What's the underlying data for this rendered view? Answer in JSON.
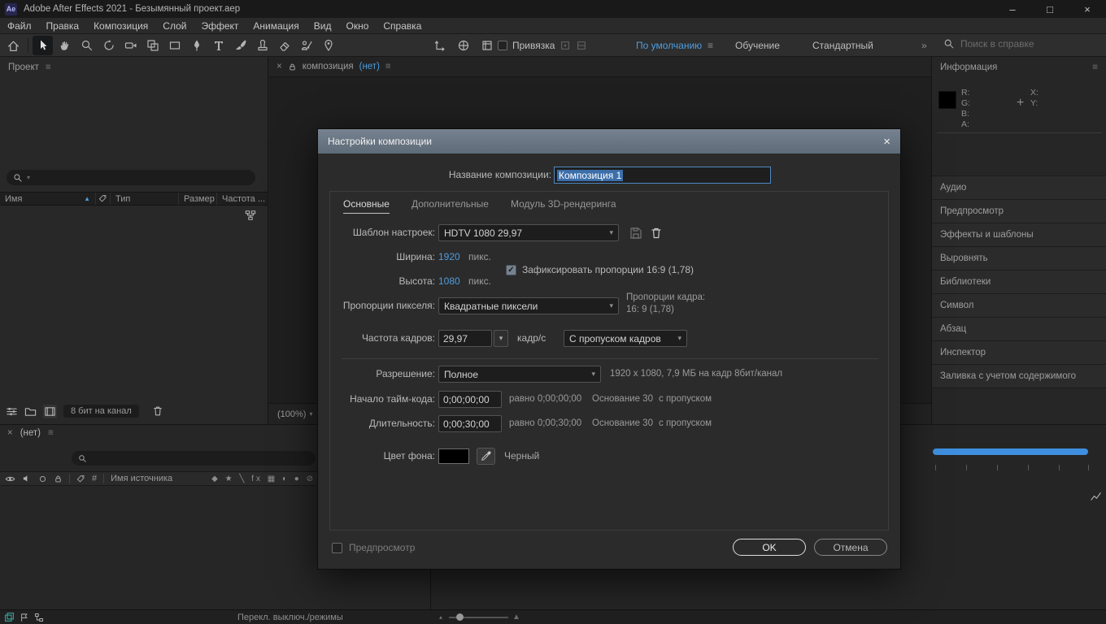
{
  "icons": {
    "hamburger": "≡",
    "chevron": "▾",
    "sort_asc": "▲",
    "close": "×",
    "minimize": "–",
    "maximize": "□",
    "overflow": "»",
    "crosshair": "+",
    "check": "✓",
    "layer_switches": "◆ ★ ╲ fx ▦ ◐ ● ⊘",
    "slider_min": "▴",
    "slider_max": "▲"
  },
  "window": {
    "app_icon": "Ae",
    "title": "Adobe After Effects 2021 - Безымянный проект.aep"
  },
  "menu": {
    "items": [
      "Файл",
      "Правка",
      "Композиция",
      "Слой",
      "Эффект",
      "Анимация",
      "Вид",
      "Окно",
      "Справка"
    ]
  },
  "toolbar": {
    "snap_label": "Привязка",
    "workspaces": {
      "default": "По умолчанию",
      "learn": "Обучение",
      "standard": "Стандартный"
    },
    "search_placeholder": "Поиск в справке"
  },
  "project": {
    "title": "Проект",
    "columns": [
      "Имя",
      "Тип",
      "Размер",
      "Частота ..."
    ],
    "bit_depth": "8 бит на канал"
  },
  "viewer": {
    "tab_label": "композиция",
    "tab_value": "(нет)",
    "zoom": "(100%)"
  },
  "info": {
    "title": "Информация",
    "r": "R:",
    "g": "G:",
    "b": "B:",
    "a": "A:",
    "x": "X:",
    "y": "Y:"
  },
  "sections": [
    "Аудио",
    "Предпросмотр",
    "Эффекты и шаблоны",
    "Выровнять",
    "Библиотеки",
    "Символ",
    "Абзац",
    "Инспектор",
    "Заливка с учетом содержимого"
  ],
  "timeline": {
    "tab": "(нет)",
    "hash": "#",
    "source": "Имя источника",
    "status": "Перекл. выключ./режимы"
  },
  "dialog": {
    "title": "Настройки композиции",
    "name_label": "Название композиции:",
    "name_value": "Композиция 1",
    "tabs": [
      "Основные",
      "Дополнительные",
      "Модуль 3D-рендеринга"
    ],
    "active_tab": "Основные",
    "preset": {
      "label": "Шаблон настроек:",
      "value": "HDTV 1080 29,97"
    },
    "width": {
      "label": "Ширина:",
      "value": "1920",
      "unit": "пикс."
    },
    "height": {
      "label": "Высота:",
      "value": "1080",
      "unit": "пикс."
    },
    "lock_aspect": "Зафиксировать пропорции 16:9 (1,78)",
    "pixel_aspect": {
      "label": "Пропорции пикселя:",
      "value": "Квадратные пиксели"
    },
    "frame_aspect": {
      "label": "Пропорции кадра:",
      "value": "16: 9 (1,78)"
    },
    "fps": {
      "label": "Частота кадров:",
      "value": "29,97",
      "unit": "кадр/с",
      "drop_mode": "С пропуском кадров"
    },
    "resolution": {
      "label": "Разрешение:",
      "value": "Полное",
      "info": "1920 x 1080, 7,9 МБ на кадр 8бит/канал"
    },
    "start": {
      "label": "Начало тайм-кода:",
      "value": "0;00;00;00",
      "equals": "равно 0;00;00;00",
      "base": "Основание 30",
      "drop": "с пропуском"
    },
    "duration": {
      "label": "Длительность:",
      "value": "0;00;30;00",
      "equals": "равно 0;00;30;00",
      "base": "Основание 30",
      "drop": "с пропуском"
    },
    "bg": {
      "label": "Цвет фона:",
      "swatch": "#000000",
      "name": "Черный"
    },
    "preview_label": "Предпросмотр",
    "ok": "OK",
    "cancel": "Отмена"
  }
}
